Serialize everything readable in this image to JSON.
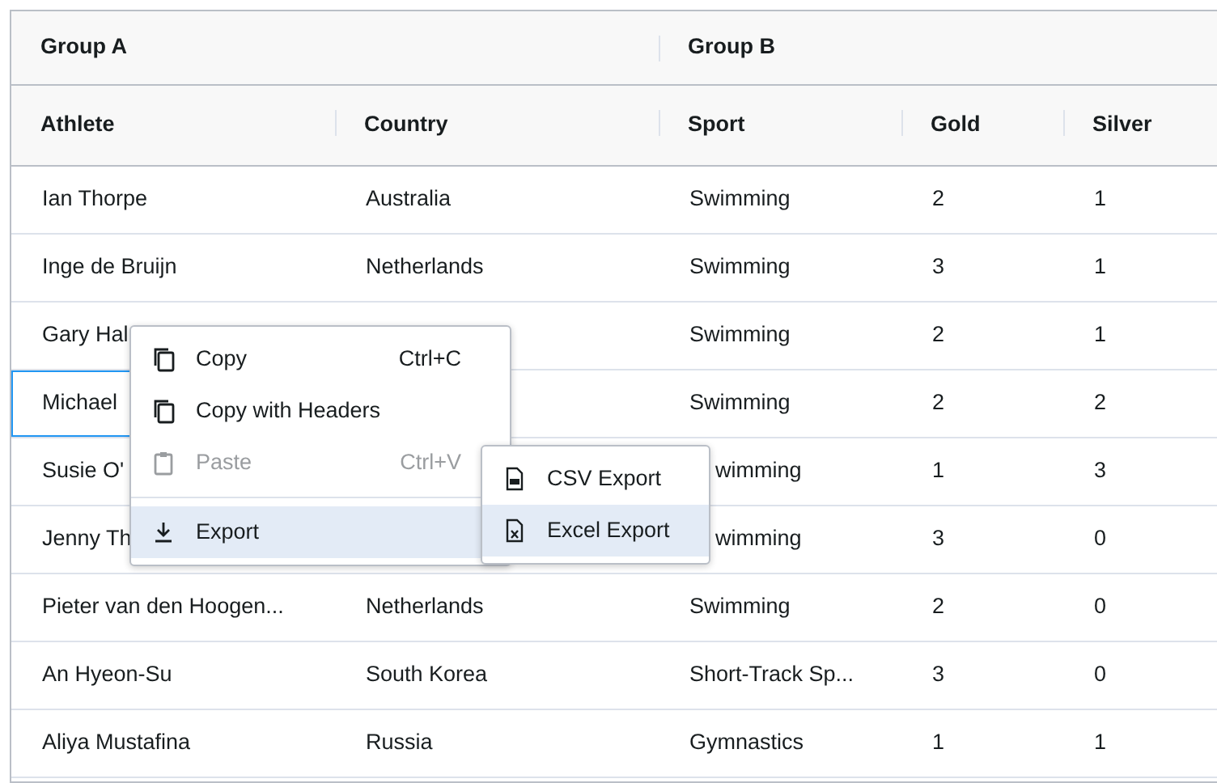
{
  "groups": [
    {
      "label": "Group A"
    },
    {
      "label": "Group B"
    }
  ],
  "columns": [
    "Athlete",
    "Country",
    "Sport",
    "Gold",
    "Silver"
  ],
  "rows": [
    {
      "cells": [
        "Ian Thorpe",
        "Australia",
        "Swimming",
        "2",
        "1"
      ],
      "focused": false,
      "sport_cut": false
    },
    {
      "cells": [
        "Inge de Bruijn",
        "Netherlands",
        "Swimming",
        "3",
        "1"
      ],
      "focused": false,
      "sport_cut": false
    },
    {
      "cells": [
        "Gary Hal",
        null,
        "Swimming",
        "2",
        "1"
      ],
      "focused": false,
      "sport_cut": false
    },
    {
      "cells": [
        "Michael",
        null,
        "Swimming",
        "2",
        "2"
      ],
      "focused": true,
      "sport_cut": false
    },
    {
      "cells": [
        "Susie O'",
        null,
        "wimming",
        "1",
        "3"
      ],
      "focused": false,
      "sport_cut": true
    },
    {
      "cells": [
        "Jenny Th",
        null,
        "wimming",
        "3",
        "0"
      ],
      "focused": false,
      "sport_cut": true
    },
    {
      "cells": [
        "Pieter van den Hoogen...",
        "Netherlands",
        "Swimming",
        "2",
        "0"
      ],
      "focused": false,
      "sport_cut": false
    },
    {
      "cells": [
        "An Hyeon-Su",
        "South Korea",
        "Short-Track Sp...",
        "3",
        "0"
      ],
      "focused": false,
      "sport_cut": false
    },
    {
      "cells": [
        "Aliya Mustafina",
        "Russia",
        "Gymnastics",
        "1",
        "1"
      ],
      "focused": false,
      "sport_cut": false
    }
  ],
  "context_menu": {
    "items": [
      {
        "kind": "item",
        "label": "Copy",
        "shortcut": "Ctrl+C",
        "disabled": false,
        "highlighted": false
      },
      {
        "kind": "item",
        "label": "Copy with Headers",
        "disabled": false,
        "highlighted": false
      },
      {
        "kind": "item",
        "label": "Paste",
        "shortcut": "Ctrl+V",
        "disabled": true,
        "highlighted": false
      },
      {
        "kind": "separator"
      },
      {
        "kind": "item",
        "label": "Export",
        "disabled": false,
        "highlighted": true
      }
    ],
    "submenu": [
      {
        "label": "CSV Export",
        "highlighted": false
      },
      {
        "label": "Excel Export",
        "highlighted": true
      }
    ]
  }
}
